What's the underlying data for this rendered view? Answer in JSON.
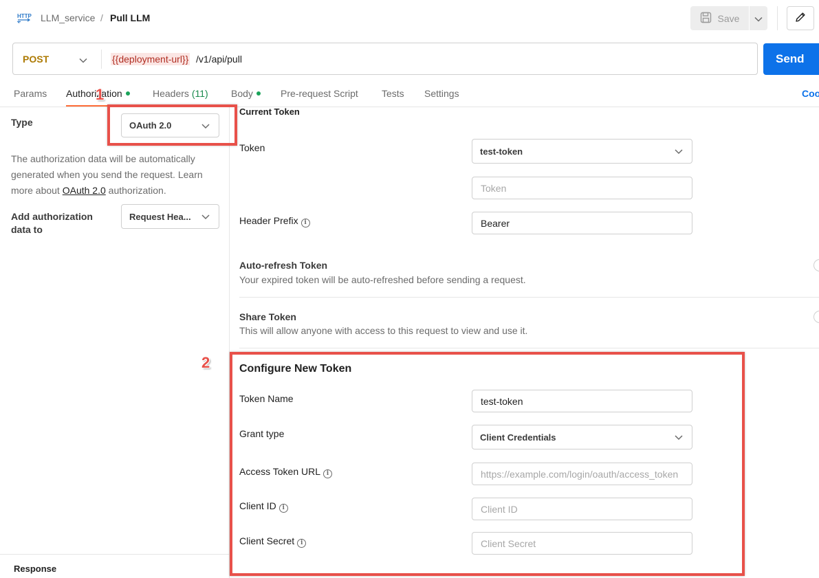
{
  "header": {
    "breadcrumb_parent": "LLM_service",
    "breadcrumb_separator": "/",
    "breadcrumb_current": "Pull LLM",
    "http_icon": "http-icon",
    "save_label": "Save"
  },
  "request": {
    "method": "POST",
    "url_variable": "{{deployment-url}}",
    "url_path": "/v1/api/pull",
    "send_label": "Send"
  },
  "tabs": {
    "params": "Params",
    "authorization": "Authorization",
    "headers": "Headers",
    "headers_count": "(11)",
    "body": "Body",
    "pre_request": "Pre-request Script",
    "tests": "Tests",
    "settings": "Settings",
    "cookies": "Coo"
  },
  "auth": {
    "type_label": "Type",
    "type_value": "OAuth 2.0",
    "description_before": "The authorization data will be automatically generated when you send the request. Learn more about ",
    "description_link": "OAuth 2.0",
    "description_after": " authorization.",
    "add_to_label": "Add authorization data to",
    "add_to_value": "Request Hea..."
  },
  "current_token": {
    "title": "Current Token",
    "token_label": "Token",
    "token_value": "test-token",
    "token_placeholder": "Token",
    "header_prefix_label": "Header Prefix",
    "header_prefix_value": "Bearer",
    "auto_refresh_title": "Auto-refresh Token",
    "auto_refresh_desc": "Your expired token will be auto-refreshed before sending a request.",
    "share_title": "Share Token",
    "share_desc": "This will allow anyone with access to this request to view and use it."
  },
  "new_token": {
    "title": "Configure New Token",
    "token_name_label": "Token Name",
    "token_name_value": "test-token",
    "grant_type_label": "Grant type",
    "grant_type_value": "Client Credentials",
    "access_token_url_label": "Access Token URL",
    "access_token_url_placeholder": "https://example.com/login/oauth/access_token",
    "client_id_label": "Client ID",
    "client_id_placeholder": "Client ID",
    "client_secret_label": "Client Secret",
    "client_secret_placeholder": "Client Secret"
  },
  "response": {
    "label": "Response"
  },
  "annotations": {
    "marker_1": "1",
    "marker_2": "2",
    "color": "#e8514a"
  },
  "colors": {
    "accent": "#ff6c37",
    "send": "#0d72e9",
    "method": "#ad7a03",
    "variable": "#b02e22",
    "status_dot": "#1aa35a"
  }
}
